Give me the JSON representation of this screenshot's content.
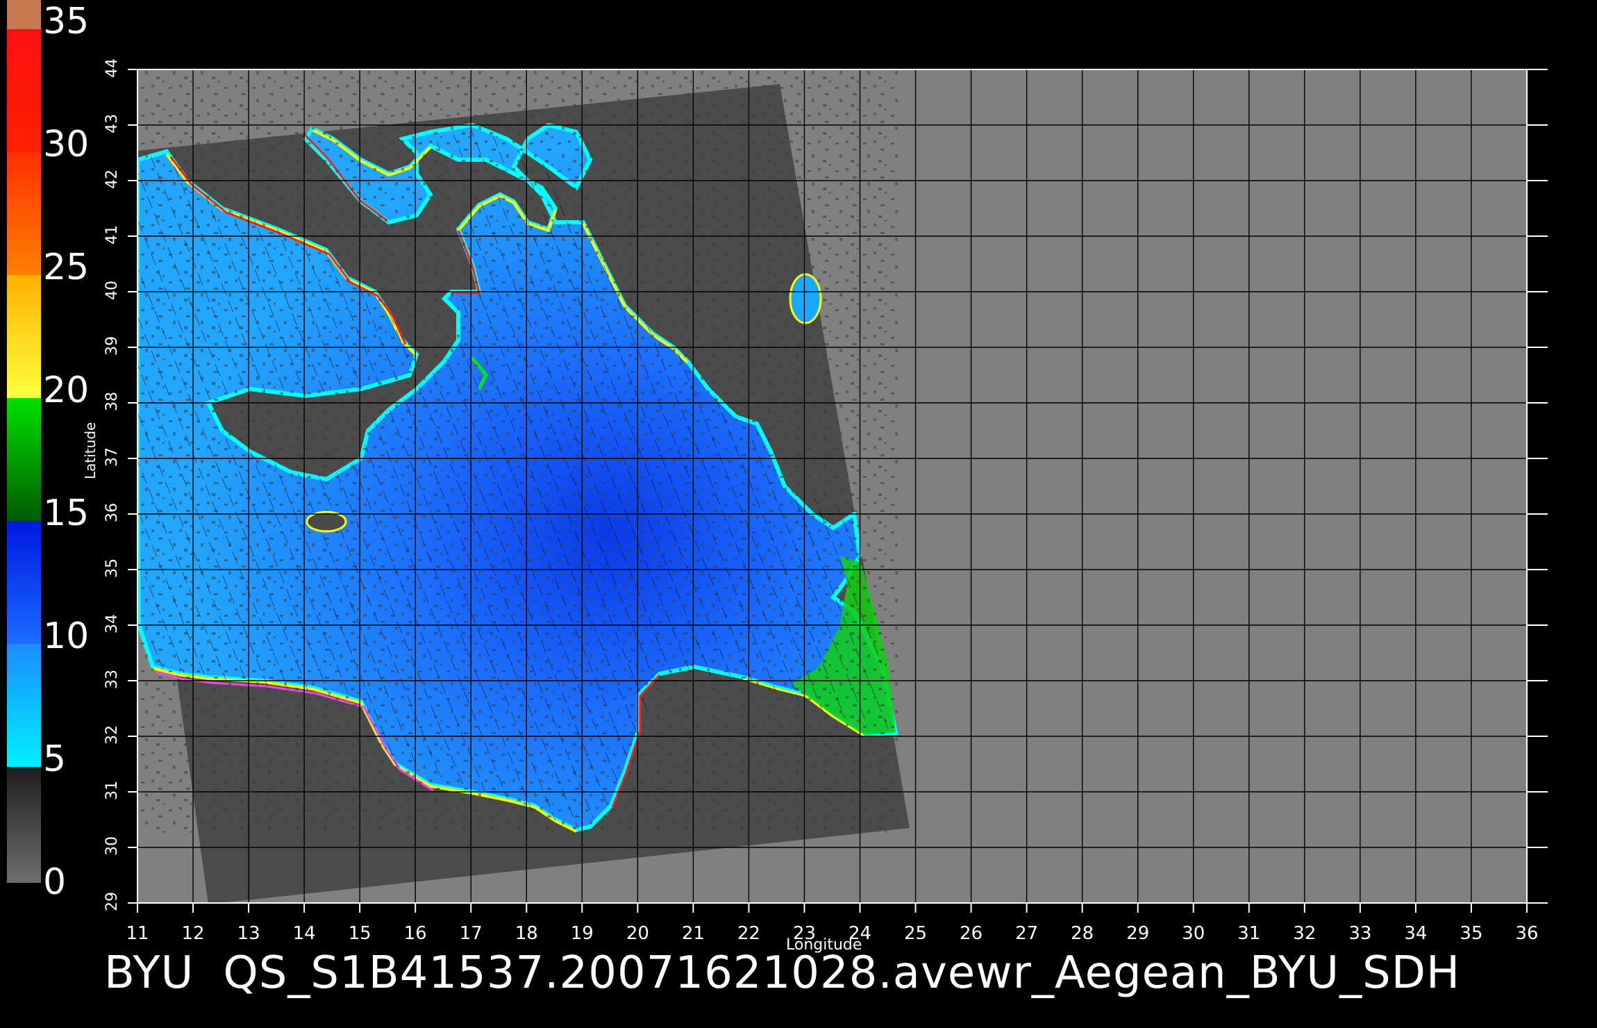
{
  "caption": {
    "source": "BYU",
    "filename": "QS_S1B41537.20071621028.avewr_Aegean_BYU_SDH"
  },
  "colorbar": {
    "ticks": [
      "0",
      "5",
      "10",
      "15",
      "20",
      "25",
      "30",
      "35"
    ],
    "bands": [
      {
        "from": 0,
        "to": 5,
        "colors": [
          "#6e6e6e",
          "#202020"
        ]
      },
      {
        "from": 5,
        "to": 10,
        "colors": [
          "#00f0ff",
          "#1a8cff"
        ]
      },
      {
        "from": 10,
        "to": 15,
        "colors": [
          "#1a6cff",
          "#0018e0"
        ]
      },
      {
        "from": 15,
        "to": 20,
        "colors": [
          "#005a00",
          "#00e000"
        ]
      },
      {
        "from": 20,
        "to": 25,
        "colors": [
          "#ffff40",
          "#ffb000"
        ]
      },
      {
        "from": 25,
        "to": 30,
        "colors": [
          "#ff8000",
          "#ff3000"
        ]
      },
      {
        "from": 30,
        "to": 35,
        "colors": [
          "#ff2000",
          "#ff1010"
        ]
      },
      {
        "from": 35,
        "to": 36,
        "colors": [
          "#c87850",
          "#c87850"
        ]
      }
    ]
  },
  "map": {
    "xlabel": "Longitude",
    "ylabel": "Latitude",
    "lon_ticks": [
      "11",
      "12",
      "13",
      "14",
      "15",
      "16",
      "17",
      "18",
      "19",
      "20",
      "21",
      "22",
      "23",
      "24",
      "25",
      "26",
      "27",
      "28",
      "29",
      "30",
      "31",
      "32",
      "33",
      "34",
      "35",
      "36"
    ],
    "lat_ticks": [
      "29",
      "30",
      "31",
      "32",
      "33",
      "34",
      "35",
      "36",
      "37",
      "38",
      "39",
      "40",
      "41",
      "42",
      "43",
      "44"
    ],
    "lon_range": [
      11,
      36
    ],
    "lat_range": [
      29,
      44
    ],
    "colors": {
      "background": "#808080",
      "swath": "#4a4a4a",
      "land": "#474747",
      "ocean_light": "#1aa8ff",
      "ocean_mid": "#2a7cff",
      "ocean_dark": "#0a40e8",
      "coast_inner": "#00ffff",
      "coast_green": "#10e010",
      "coast_yellow": "#ffff00",
      "coast_red": "#ff2020",
      "coast_magenta": "#ff40ff",
      "grid": "#000000"
    }
  }
}
